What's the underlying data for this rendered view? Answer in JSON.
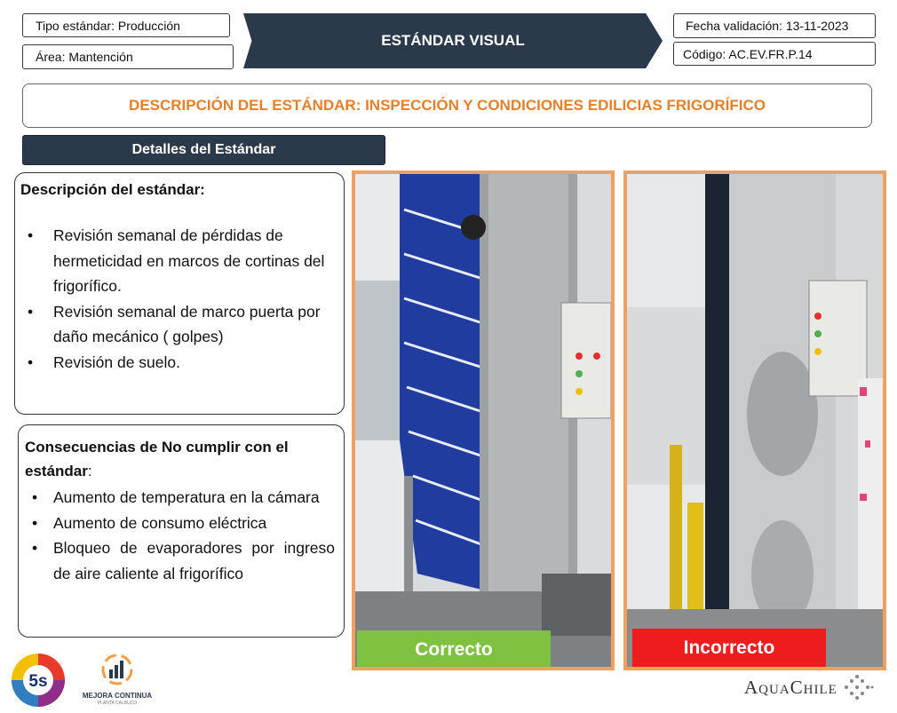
{
  "header": {
    "tipo": "Tipo estándar: Producción",
    "area": "Área: Mantención",
    "banner": "ESTÁNDAR VISUAL",
    "fecha": "Fecha validación: 13-11-2023",
    "codigo": "Código: AC.EV.FR.P.14"
  },
  "title": "DESCRIPCIÓN DEL ESTÁNDAR: INSPECCIÓN Y CONDICIONES EDILICIAS FRIGORÍFICO",
  "details_label": "Detalles del Estándar",
  "description": {
    "heading": "Descripción del estándar:",
    "items": [
      "Revisión semanal de pérdidas de hermeticidad en marcos de cortinas del frigorífico.",
      "Revisión semanal de marco puerta por daño mecánico ( golpes)",
      "Revisión de suelo."
    ]
  },
  "consequences": {
    "heading": "Consecuencias de No cumplir con el estándar",
    "heading_suffix": ":",
    "items": [
      "Aumento de temperatura en la cámara",
      "Aumento de consumo eléctrica",
      "Bloqueo de evaporadores por ingreso de aire caliente al frigorífico"
    ]
  },
  "photos": {
    "correct_label": "Correcto",
    "incorrect_label": "Incorrecto",
    "correct_color": "#7fc241",
    "incorrect_color": "#ee1c1c"
  },
  "footer": {
    "logo_5s": "5s",
    "mejora_line1": "MEJORA CONTINUA",
    "mejora_line2": "PLANTA CALBUCO",
    "aquachile": "AquaChile"
  }
}
